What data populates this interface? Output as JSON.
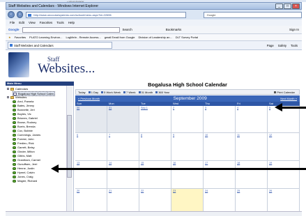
{
  "browser": {
    "tooltip": "« school character",
    "window_title": "Staff Websites and Calendars - Windows Internet Explorer",
    "address": "http://www.oncoursesystems.com/school/menu.aspx?id=22696",
    "search_placeholder": "Google",
    "menus": [
      "File",
      "Edit",
      "View",
      "Favorites",
      "Tools",
      "Help"
    ],
    "google_label": "Google",
    "google_search_label": "Search",
    "bookmarks_label": "Bookmarks",
    "signin_label": "Sign In",
    "favorites_label": "Favorites",
    "favorites": [
      "PLATO Learning Environ...",
      "LogMeIn - Remote Access...",
      "gmail Email from Google",
      "Division of Leadership an...",
      "DLT Survey Portal"
    ],
    "tab_label": "Staff Websites and Calendars",
    "command_items": [
      "Page",
      "Safety",
      "Tools"
    ]
  },
  "site": {
    "logo_staff": "Staff",
    "logo_websites": "Websites..."
  },
  "sidebar": {
    "header": "Main Menu",
    "calendars_label": "Calendars",
    "school_calendar": "Bogalusa High School Calen",
    "websites_label": "Websites",
    "teachers": [
      "Arrd, Pamela",
      "Bates, Jimmy",
      "Bonnette, Jeri",
      "Boyles, Vic",
      "Briones, Gabriel",
      "Brown, Rodney",
      "Burris, Brenda",
      "Cox, Bobbie",
      "Cummings, James",
      "Forrest, John",
      "Fredieu, Rick",
      "Garrett, Betsy",
      "Ginder, Milton",
      "Gibbs, Matt",
      "Grantham, Carmel",
      "Gunuffsen, Jerri",
      "Henne, Justin",
      "Hymel, Calvin",
      "Jones, Craig",
      "Magee, Richard"
    ]
  },
  "calendar": {
    "title": "Bogalusa High School Calendar",
    "views": [
      "Today",
      "1 Day",
      "5 Work Week",
      "7 Week",
      "31 Month",
      "365 Year"
    ],
    "print_label": "Print Calendar",
    "prev_label": "« Previous Month",
    "next_label": "Next Month »",
    "month_label": "September 2009",
    "weekdays": [
      "Sun",
      "Mon",
      "Tue",
      "Wed",
      "Thu",
      "Fri",
      "Sat"
    ],
    "weeks": [
      [
        "30",
        "31",
        "Sep 1",
        "2",
        "3",
        "4",
        "5"
      ],
      [
        "6",
        "7",
        "8",
        "9",
        "10",
        "11",
        "12"
      ],
      [
        "13",
        "14",
        "15",
        "16",
        "17",
        "18",
        "19"
      ],
      [
        "20",
        "21",
        "22",
        "23",
        "24",
        "25",
        "26"
      ]
    ]
  },
  "colors": {
    "calendar_nav": "#3a66b8",
    "calendar_header": "#2e57a6",
    "sidebar_header": "#23407e",
    "today_cell": "#fff6c4"
  }
}
